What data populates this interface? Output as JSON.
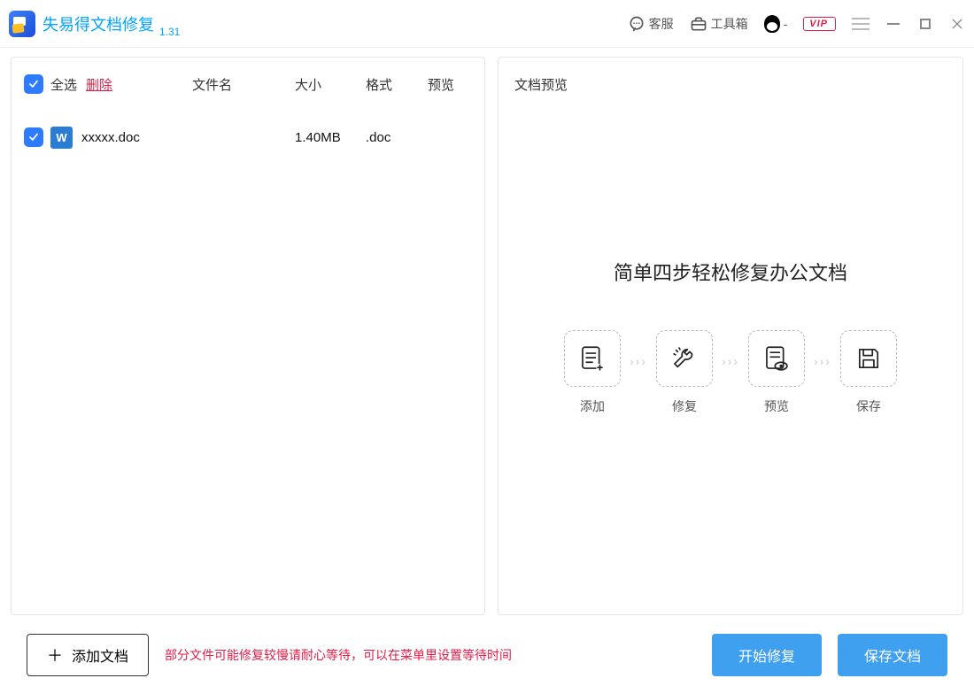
{
  "app": {
    "title": "失易得文档修复",
    "version": "1.31"
  },
  "titlebar": {
    "service": "客服",
    "toolbox": "工具箱",
    "qq": "-",
    "vip": "VIP"
  },
  "list": {
    "header": {
      "selectAll": "全选",
      "delete": "删除",
      "filename": "文件名",
      "size": "大小",
      "format": "格式",
      "preview": "预览"
    },
    "rows": [
      {
        "name": "xxxxx.doc",
        "size": "1.40MB",
        "format": ".doc"
      }
    ]
  },
  "preview": {
    "title": "文档预览",
    "headline": "简单四步轻松修复办公文档",
    "steps": [
      "添加",
      "修复",
      "预览",
      "保存"
    ]
  },
  "footer": {
    "add": "添加文档",
    "hint": "部分文件可能修复较慢请耐心等待，可以在菜单里设置等待时间",
    "start": "开始修复",
    "save": "保存文档"
  }
}
